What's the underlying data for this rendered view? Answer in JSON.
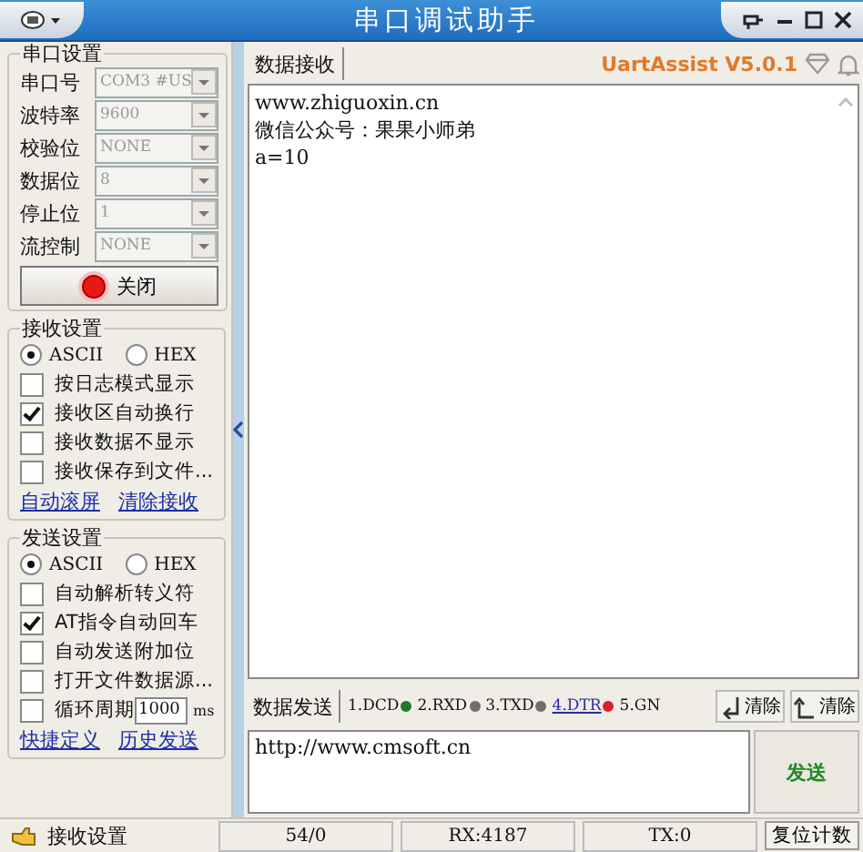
{
  "window": {
    "title": "串口调试助手"
  },
  "serial_settings": {
    "title": "串口设置",
    "fields": [
      {
        "label": "串口号",
        "value": "COM3 #US",
        "disabled": true
      },
      {
        "label": "波特率",
        "value": "9600",
        "disabled": true
      },
      {
        "label": "校验位",
        "value": "NONE",
        "disabled": true
      },
      {
        "label": "数据位",
        "value": "8",
        "disabled": true
      },
      {
        "label": "停止位",
        "value": "1",
        "disabled": true
      },
      {
        "label": "流控制",
        "value": "NONE",
        "disabled": true
      }
    ],
    "port_button": {
      "label": "关闭",
      "on": true
    }
  },
  "receive_settings": {
    "title": "接收设置",
    "modes": [
      {
        "label": "ASCII",
        "selected": true
      },
      {
        "label": "HEX",
        "selected": false
      }
    ],
    "options": [
      {
        "kind": "checkbox",
        "label": "按日志模式显示",
        "checked": false
      },
      {
        "kind": "checkbox",
        "label": "接收区自动换行",
        "checked": true
      },
      {
        "kind": "checkbox",
        "label": "接收数据不显示",
        "checked": false
      },
      {
        "kind": "checkbox",
        "label": "接收保存到文件...",
        "checked": false
      }
    ],
    "links": [
      "自动滚屏",
      "清除接收"
    ]
  },
  "send_settings": {
    "title": "发送设置",
    "modes": [
      {
        "label": "ASCII",
        "selected": true
      },
      {
        "label": "HEX",
        "selected": false
      }
    ],
    "options": [
      {
        "kind": "checkbox",
        "label": "自动解析转义符",
        "checked": false
      },
      {
        "kind": "checkbox",
        "label": "AT指令自动回车",
        "checked": true
      },
      {
        "kind": "checkbox",
        "label": "自动发送附加位",
        "checked": false
      },
      {
        "kind": "checkbox",
        "label": "打开文件数据源...",
        "checked": false
      },
      {
        "kind": "period",
        "label": "循环周期",
        "checked": false,
        "value": "1000",
        "unit": "ms"
      }
    ],
    "links": [
      "快捷定义",
      "历史发送"
    ]
  },
  "receive": {
    "tab": "数据接收",
    "brand": "UartAssist V5.0.1",
    "lines": [
      "www.zhiguoxin.cn",
      "微信公众号：果果小师弟",
      "a=10"
    ]
  },
  "send": {
    "tab": "数据发送",
    "signals": [
      {
        "label": "1.DCD",
        "kind": "label",
        "color": "#1f7a2a"
      },
      {
        "label": "2.RXD",
        "kind": "label",
        "color": "#6e6e6e"
      },
      {
        "label": "3.TXD",
        "kind": "label",
        "color": "#6e6e6e"
      },
      {
        "label": "4.DTR",
        "kind": "link",
        "color": "#d8202e"
      },
      {
        "label": "5.GN",
        "kind": "label"
      }
    ],
    "clear_buttons": [
      {
        "label": "清除",
        "kind": "down"
      },
      {
        "label": "清除",
        "kind": "up"
      }
    ],
    "input": "http://www.cmsoft.cn",
    "send_button": "发送"
  },
  "status_bar": {
    "section": "接收设置",
    "counts": [
      "54/0",
      "RX:4187",
      "TX:0"
    ],
    "reset_button": "复位计数"
  }
}
